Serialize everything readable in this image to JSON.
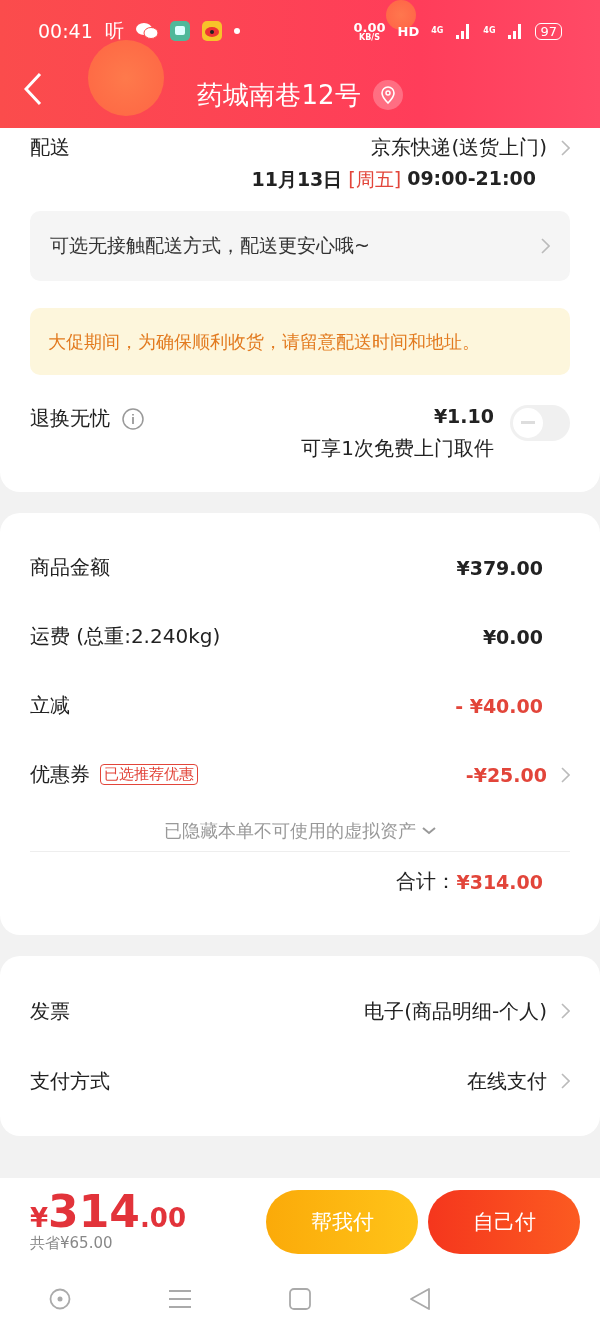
{
  "status_bar": {
    "time": "00:41",
    "app_text": "听",
    "speed": "0.00",
    "speed_unit": "KB/S",
    "hd": "HD",
    "network_1": "4G",
    "network_2": "4G",
    "battery": "97"
  },
  "header": {
    "title": "药城南巷12号"
  },
  "delivery": {
    "label": "配送",
    "method": "京东快递(送货上门)",
    "date": "11月13日",
    "weekday": "[周五]",
    "time": "09:00-21:00"
  },
  "contactless": {
    "text": "可选无接触配送方式，配送更安心哦~"
  },
  "notice": {
    "text": "大促期间，为确保顺利收货，请留意配送时间和地址。"
  },
  "return_service": {
    "label": "退换无忧",
    "price": "¥1.10",
    "note": "可享1次免费上门取件",
    "on": false
  },
  "price_rows": [
    {
      "label": "商品金额",
      "amount": "¥379.00",
      "kind": "normal"
    },
    {
      "label": "运费 (总重:2.240kg)",
      "amount": "¥0.00",
      "kind": "normal"
    },
    {
      "label": "立减",
      "amount": "- ¥40.00",
      "kind": "discount"
    },
    {
      "label": "优惠券",
      "tag": "已选推荐优惠",
      "amount": "-¥25.00",
      "kind": "coupon"
    }
  ],
  "hidden_note": "已隐藏本单不可使用的虚拟资产",
  "total": {
    "label": "合计：",
    "amount": "¥314.00"
  },
  "options": [
    {
      "label": "发票",
      "value": "电子(商品明细-个人)"
    },
    {
      "label": "支付方式",
      "value": "在线支付"
    }
  ],
  "footer": {
    "currency": "¥",
    "integer": "314",
    "decimal": ".00",
    "saved": "共省¥65.00",
    "buttons": [
      {
        "label": "帮我付",
        "kind": "secondary"
      },
      {
        "label": "自己付",
        "kind": "primary"
      }
    ]
  }
}
